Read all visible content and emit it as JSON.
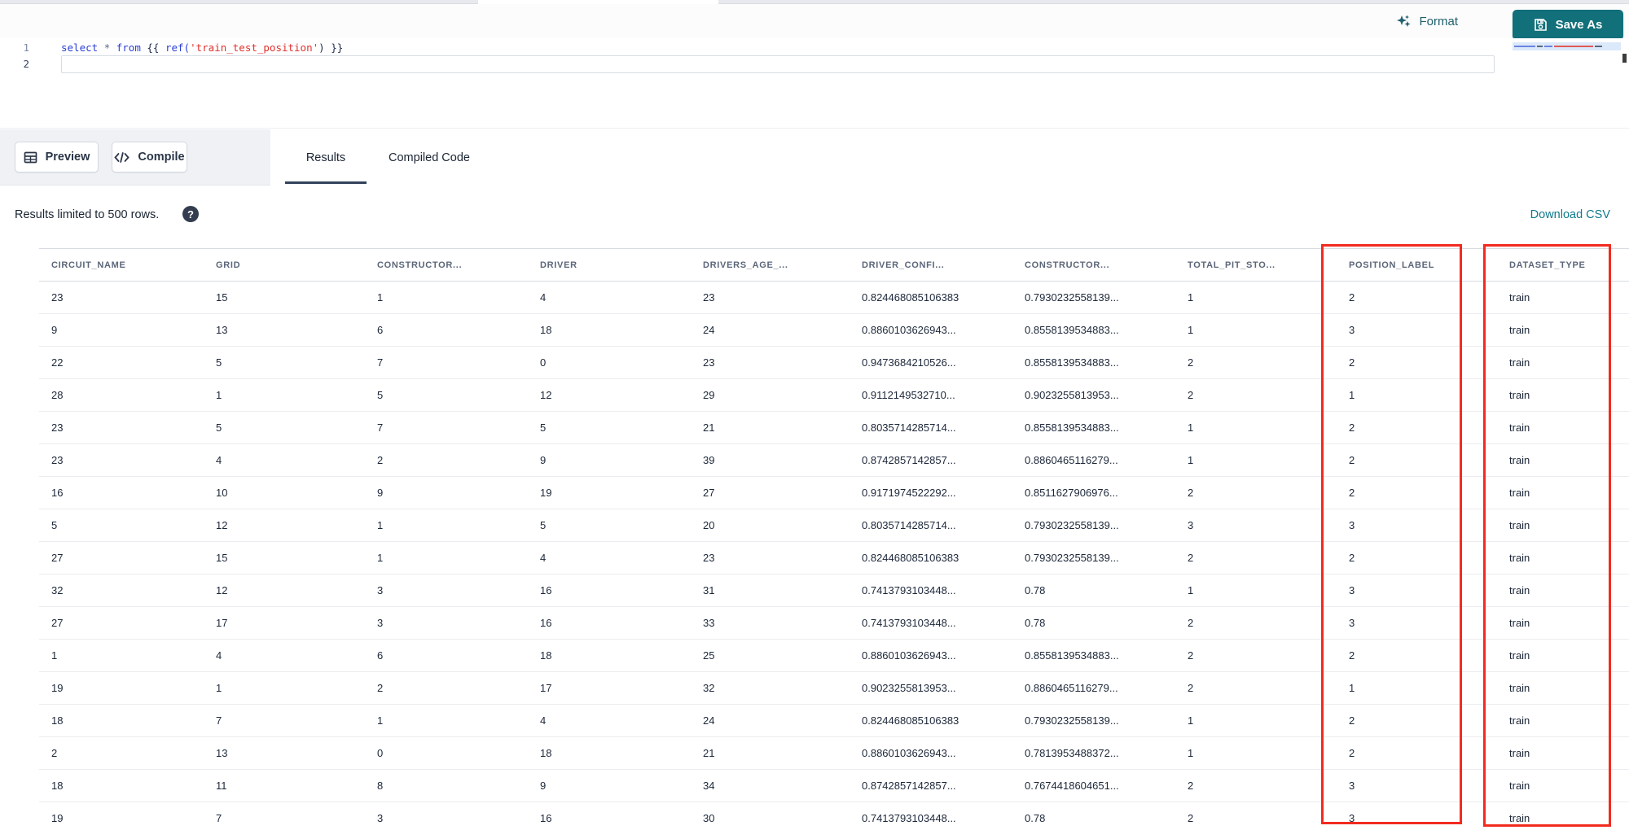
{
  "top_bar": {
    "format_label": "Format",
    "save_as_label": "Save As"
  },
  "editor": {
    "line_numbers": {
      "line1": "1",
      "line2": "2"
    },
    "line1_tokens": {
      "kw_select": "select",
      "star": "*",
      "kw_from": "from",
      "brace_open": "{{",
      "fn_ref": "ref(",
      "string": "'train_test_position'",
      "close": ") }}"
    }
  },
  "toolbar": {
    "preview_label": "Preview",
    "compile_label": "Compile",
    "tabs": [
      {
        "label": "Results",
        "active": true
      },
      {
        "label": "Compiled Code",
        "active": false
      }
    ]
  },
  "results_bar": {
    "limit_text": "Results limited to 500 rows.",
    "help_glyph": "?",
    "download_csv_label": "Download CSV"
  },
  "results_table": {
    "columns": [
      "CIRCUIT_NAME",
      "GRID",
      "CONSTRUCTOR...",
      "DRIVER",
      "DRIVERS_AGE_...",
      "DRIVER_CONFI...",
      "CONSTRUCTOR...",
      "TOTAL_PIT_STO...",
      "POSITION_LABEL",
      "DATASET_TYPE"
    ],
    "rows": [
      [
        "23",
        "15",
        "1",
        "4",
        "23",
        "0.824468085106383",
        "0.7930232558139...",
        "1",
        "2",
        "train"
      ],
      [
        "9",
        "13",
        "6",
        "18",
        "24",
        "0.8860103626943...",
        "0.8558139534883...",
        "1",
        "3",
        "train"
      ],
      [
        "22",
        "5",
        "7",
        "0",
        "23",
        "0.9473684210526...",
        "0.8558139534883...",
        "2",
        "2",
        "train"
      ],
      [
        "28",
        "1",
        "5",
        "12",
        "29",
        "0.9112149532710...",
        "0.9023255813953...",
        "2",
        "1",
        "train"
      ],
      [
        "23",
        "5",
        "7",
        "5",
        "21",
        "0.8035714285714...",
        "0.8558139534883...",
        "1",
        "2",
        "train"
      ],
      [
        "23",
        "4",
        "2",
        "9",
        "39",
        "0.8742857142857...",
        "0.8860465116279...",
        "1",
        "2",
        "train"
      ],
      [
        "16",
        "10",
        "9",
        "19",
        "27",
        "0.9171974522292...",
        "0.8511627906976...",
        "2",
        "2",
        "train"
      ],
      [
        "5",
        "12",
        "1",
        "5",
        "20",
        "0.8035714285714...",
        "0.7930232558139...",
        "3",
        "3",
        "train"
      ],
      [
        "27",
        "15",
        "1",
        "4",
        "23",
        "0.824468085106383",
        "0.7930232558139...",
        "2",
        "2",
        "train"
      ],
      [
        "32",
        "12",
        "3",
        "16",
        "31",
        "0.7413793103448...",
        "0.78",
        "1",
        "3",
        "train"
      ],
      [
        "27",
        "17",
        "3",
        "16",
        "33",
        "0.7413793103448...",
        "0.78",
        "2",
        "3",
        "train"
      ],
      [
        "1",
        "4",
        "6",
        "18",
        "25",
        "0.8860103626943...",
        "0.8558139534883...",
        "2",
        "2",
        "train"
      ],
      [
        "19",
        "1",
        "2",
        "17",
        "32",
        "0.9023255813953...",
        "0.8860465116279...",
        "2",
        "1",
        "train"
      ],
      [
        "18",
        "7",
        "1",
        "4",
        "24",
        "0.824468085106383",
        "0.7930232558139...",
        "1",
        "2",
        "train"
      ],
      [
        "2",
        "13",
        "0",
        "18",
        "21",
        "0.8860103626943...",
        "0.7813953488372...",
        "1",
        "2",
        "train"
      ],
      [
        "18",
        "11",
        "8",
        "9",
        "34",
        "0.8742857142857...",
        "0.7674418604651...",
        "2",
        "3",
        "train"
      ],
      [
        "19",
        "7",
        "3",
        "16",
        "30",
        "0.7413793103448...",
        "0.78",
        "2",
        "3",
        "train"
      ]
    ]
  },
  "annotations": {
    "highlight_color": "#f22b20",
    "highlighted_columns": [
      "POSITION_LABEL",
      "DATASET_TYPE"
    ]
  },
  "colors": {
    "accent_teal": "#12707a",
    "link_teal": "#10798e",
    "keyword_blue": "#2a3fd4",
    "string_red": "#e0302c"
  }
}
